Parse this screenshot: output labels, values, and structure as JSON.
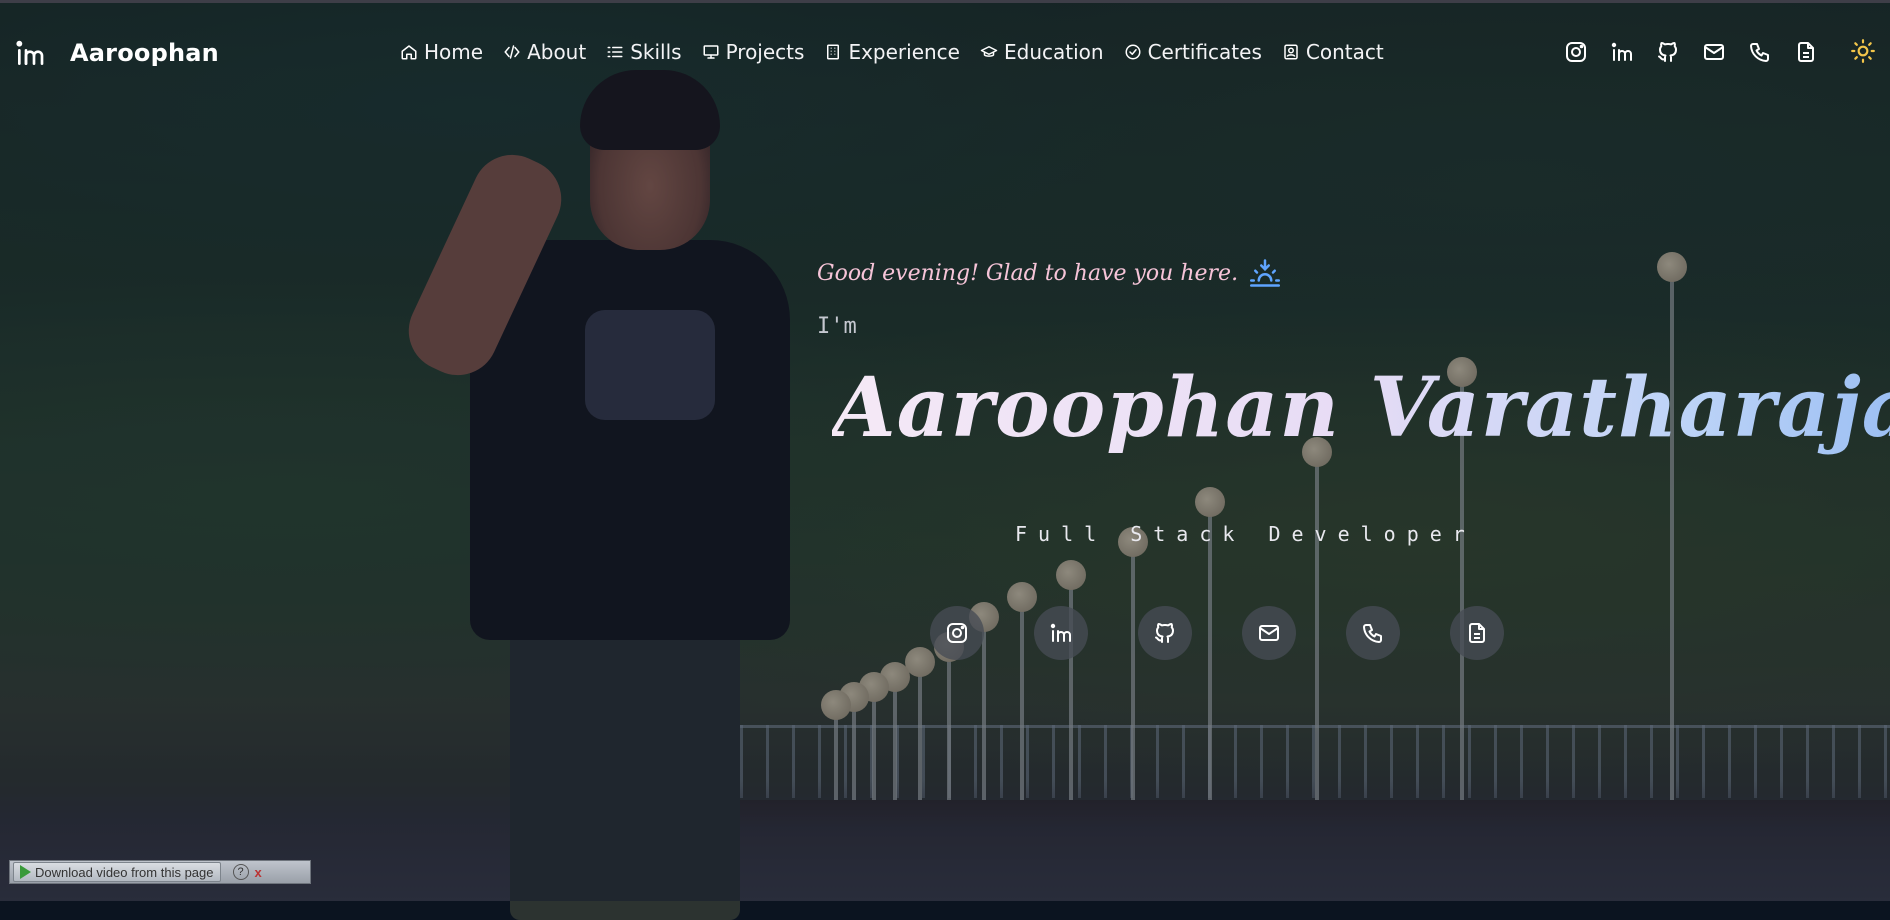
{
  "brand": {
    "name": "Aaroophan",
    "logo_icon": "linkedin-icon"
  },
  "nav": [
    {
      "label": "Home",
      "icon": "home-icon"
    },
    {
      "label": "About",
      "icon": "code-icon"
    },
    {
      "label": "Skills",
      "icon": "list-icon"
    },
    {
      "label": "Projects",
      "icon": "presentation-icon"
    },
    {
      "label": "Experience",
      "icon": "building-icon"
    },
    {
      "label": "Education",
      "icon": "graduation-cap-icon"
    },
    {
      "label": "Certificates",
      "icon": "badge-check-icon"
    },
    {
      "label": "Contact",
      "icon": "contact-card-icon"
    }
  ],
  "social_icons": [
    "instagram-icon",
    "linkedin-icon",
    "github-icon",
    "mail-icon",
    "phone-icon",
    "resume-icon"
  ],
  "theme_toggle_icon": "sun-icon",
  "hero": {
    "greeting": "Good evening! Glad to have you here.",
    "greeting_icon": "sunset-icon",
    "intro": "I'm",
    "name": "Aaroophan Varatharajan",
    "role": "Full Stack Developer"
  },
  "colors": {
    "greeting": "#f6c4d8",
    "name_gradient_start": "#f5e9f6",
    "name_gradient_end": "#8fb7f2",
    "sunset_icon": "#5fa4ff",
    "sun_icon": "#f3c64a"
  },
  "download_bar": {
    "label": "Download video from this page",
    "help": "?",
    "close": "x"
  }
}
